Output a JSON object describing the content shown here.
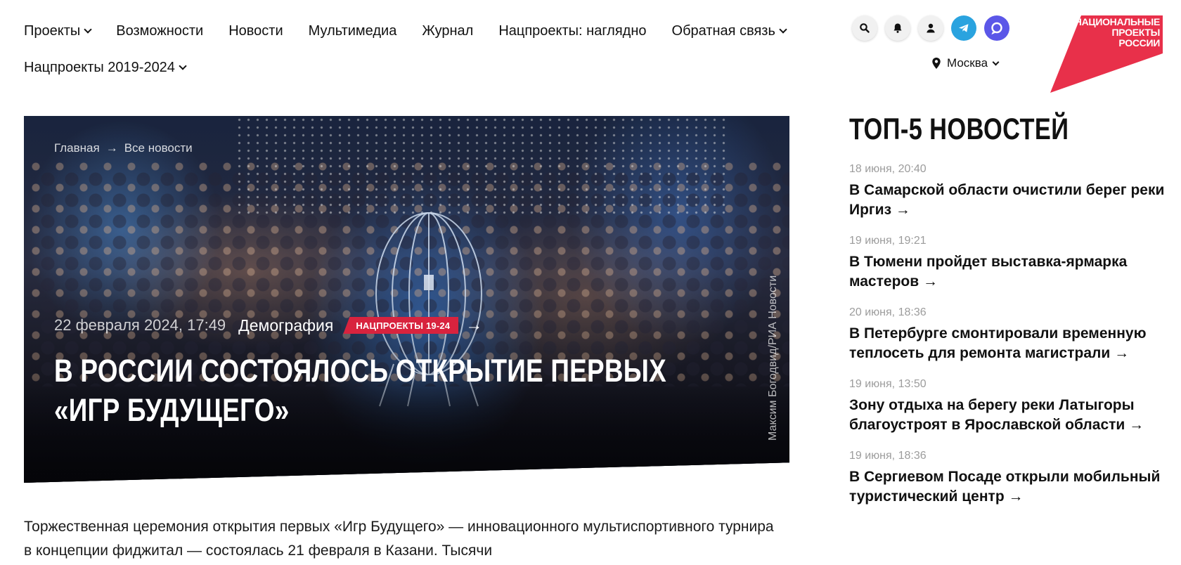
{
  "nav": {
    "row1": [
      {
        "label": "Проекты",
        "dropdown": true
      },
      {
        "label": "Возможности",
        "dropdown": false
      },
      {
        "label": "Новости",
        "dropdown": false
      },
      {
        "label": "Мультимедиа",
        "dropdown": false
      },
      {
        "label": "Журнал",
        "dropdown": false
      },
      {
        "label": "Нацпроекты: наглядно",
        "dropdown": false
      },
      {
        "label": "Обратная связь",
        "dropdown": true
      }
    ],
    "row2": [
      {
        "label": "Нацпроекты 2019-2024",
        "dropdown": true
      }
    ]
  },
  "header_icons": [
    "search-icon",
    "bell-icon",
    "user-icon",
    "telegram-icon",
    "max-messenger-icon"
  ],
  "city": {
    "label": "Москва"
  },
  "logo": {
    "line1": "НАЦИОНАЛЬНЫЕ",
    "line2": "ПРОЕКТЫ",
    "line3": "РОССИИ",
    "color": "#e8304a"
  },
  "hero": {
    "breadcrumb": {
      "home": "Главная",
      "arrow": "→",
      "section": "Все новости"
    },
    "date": "22 февраля 2024, 17:49",
    "category": "Демография",
    "badge": "НАЦПРОЕКТЫ 19-24",
    "badge_color": "#d8233e",
    "arrow": "→",
    "title": "В России состоялось открытие первых «Игр Будущего»",
    "photo_credit": "Максим Богодвид/РИА Новости"
  },
  "article": {
    "lead": "Торжественная церемония открытия первых «Игр Будущего» — инновационного мультиспортивного турнира в концепции фиджитал — состоялась 21 февраля в Казани. Тысячи"
  },
  "top5": {
    "title": "ТОП-5 НОВОСТЕЙ",
    "items": [
      {
        "date": "18 июня, 20:40",
        "title": "В Самарской области очистили берег реки Иргиз →"
      },
      {
        "date": "19 июня, 19:21",
        "title": "В Тюмени пройдет выставка-ярмарка мастеров →"
      },
      {
        "date": "20 июня, 18:36",
        "title": "В Петербурге смонтировали временную теплосеть для ремонта магистрали →"
      },
      {
        "date": "19 июня, 13:50",
        "title": "Зону отдыха на берегу реки Латыгоры благоустроят в Ярославской области →"
      },
      {
        "date": "19 июня, 18:36",
        "title": "В Сергиевом Посаде открыли мобильный туристический центр →"
      }
    ]
  }
}
